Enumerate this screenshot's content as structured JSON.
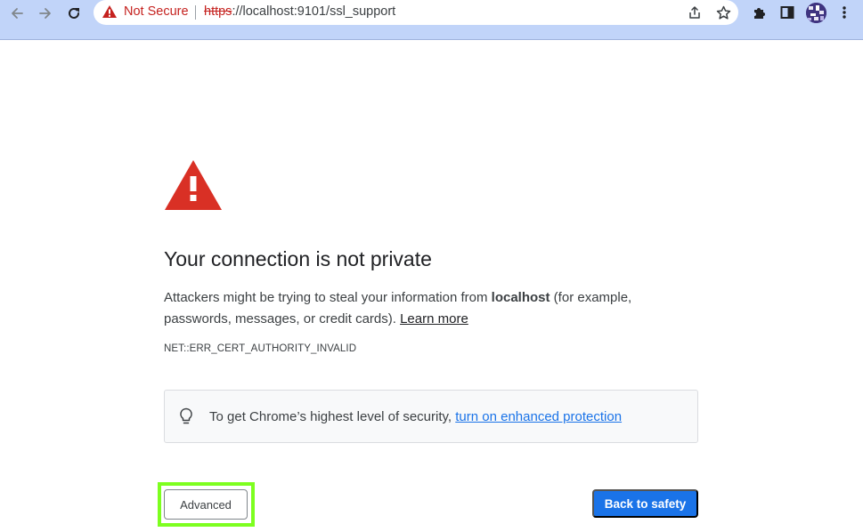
{
  "browser": {
    "security_label": "Not Secure",
    "url_scheme": "https",
    "url_rest": "://localhost:9101/ssl_support",
    "icons": {
      "back": "back-arrow-icon",
      "forward": "forward-arrow-icon",
      "reload": "reload-icon",
      "warning": "warning-icon",
      "share": "share-icon",
      "bookmark": "star-icon",
      "extensions": "puzzle-icon",
      "side_panel": "side-panel-icon",
      "menu": "kebab-menu-icon"
    }
  },
  "interstitial": {
    "heading": "Your connection is not private",
    "explanation_pre": "Attackers might be trying to steal your information from ",
    "host": "localhost",
    "explanation_post": " (for example, passwords, messages, or credit cards). ",
    "learn_more": "Learn more",
    "error_code": "NET::ERR_CERT_AUTHORITY_INVALID",
    "enhanced_text": "To get Chrome’s highest level of security, ",
    "enhanced_link": "turn on enhanced protection",
    "advanced_label": "Advanced",
    "back_to_safety_label": "Back to safety"
  },
  "colors": {
    "toolbar_bg": "#c1d4f9",
    "danger_red": "#d93025",
    "link_blue": "#1a73e8",
    "highlight": "#7dff1f"
  }
}
